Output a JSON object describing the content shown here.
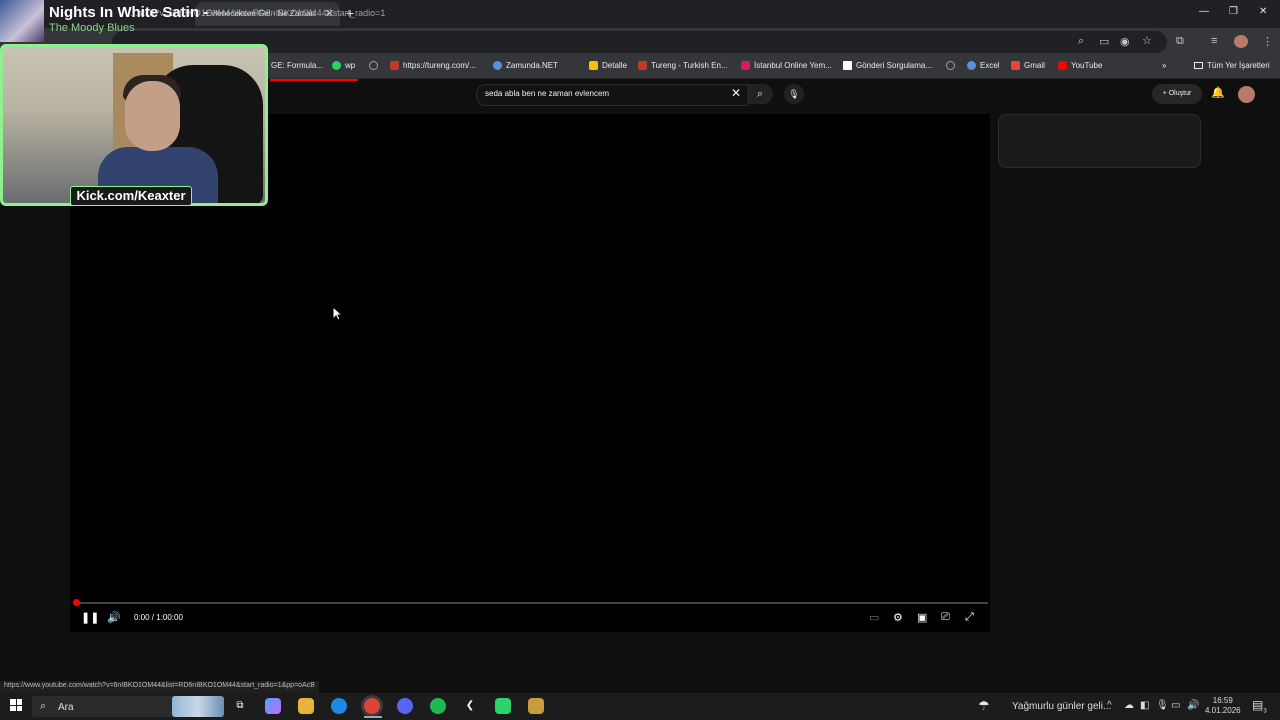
{
  "browser": {
    "tab_title": "Evleneceksen Gel - Ne Zaman E",
    "url": "...atch?v=6nIBKO1OM44&list=RD6nIBKO1OM44&start_radio=1",
    "status_url": "https://www.youtube.com/watch?v=6nIBKO1OM44&list=RD6nIBKO1OM44&start_radio=1&pp=oAcB"
  },
  "bookmarks": {
    "items": [
      {
        "label": "GE: Formula...",
        "color": "#1a73e8"
      },
      {
        "label": "wp",
        "color": "#25d366"
      },
      {
        "label": "",
        "color": "#9aa0a6"
      },
      {
        "label": "https://tureng.com/...",
        "color": "#c0392b"
      },
      {
        "label": "Zamunda.NET",
        "color": "#5b8fd6"
      },
      {
        "label": "Detalle",
        "color": "#f4c20d"
      },
      {
        "label": "Tureng - Turkish En...",
        "color": "#c0392b"
      },
      {
        "label": "İstanbul Online Yem...",
        "color": "#d81b60"
      },
      {
        "label": "Gönderi Sorgulama...",
        "color": "#ffffff"
      },
      {
        "label": "",
        "color": "#9aa0a6"
      },
      {
        "label": "Excel",
        "color": "#5b8fd6"
      },
      {
        "label": "Gmail",
        "color": "#ea4335"
      },
      {
        "label": "YouTube",
        "color": "#ff0000"
      }
    ],
    "all_bookmarks": "Tüm Yer İşaretleri"
  },
  "youtube": {
    "search_value": "seda abla ben ne zaman evlencem",
    "create_label": "Oluştur"
  },
  "player": {
    "time": "0:00 / 1:00:00",
    "progress": 0.0
  },
  "overlay": {
    "now_playing_title": "Nights In White Satin -",
    "now_playing_artist": "The Moody Blues",
    "stream_label": "Kick.com/Keaxter"
  },
  "taskbar": {
    "search_label": "Ara",
    "weather": "Yağmurlu günler geli...",
    "time": "16:59",
    "date": "4.01.2026",
    "notifications": "3"
  },
  "colors": {
    "accent_red": "#ff0000",
    "overlay_green": "#8ef08e"
  }
}
